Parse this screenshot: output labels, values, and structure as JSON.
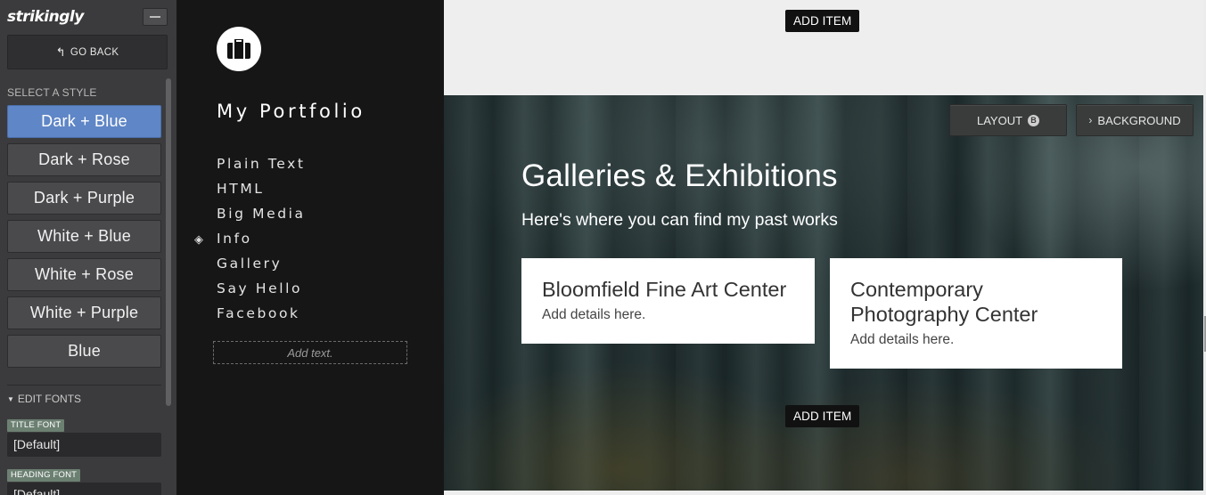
{
  "editor": {
    "logo": "strikingly",
    "go_back": "GO BACK",
    "select_style_label": "SELECT A STYLE",
    "styles": [
      {
        "label": "Dark + Blue",
        "active": true
      },
      {
        "label": "Dark + Rose",
        "active": false
      },
      {
        "label": "Dark + Purple",
        "active": false
      },
      {
        "label": "White + Blue",
        "active": false
      },
      {
        "label": "White + Rose",
        "active": false
      },
      {
        "label": "White + Purple",
        "active": false
      },
      {
        "label": "Blue",
        "active": false
      }
    ],
    "edit_fonts": "EDIT FONTS",
    "title_font_label": "TITLE FONT",
    "title_font_value": "[Default]",
    "heading_font_label": "HEADING FONT",
    "heading_font_value": "[Default]"
  },
  "site": {
    "title": "My Portfolio",
    "nav": [
      "Plain Text",
      "HTML",
      "Big Media",
      "Info",
      "Gallery",
      "Say Hello",
      "Facebook"
    ],
    "active_nav_index": 3,
    "add_text": "Add text."
  },
  "main": {
    "add_item_top": "ADD ITEM",
    "add_item_bottom": "ADD ITEM",
    "layout_button": "LAYOUT",
    "layout_badge": "B",
    "background_button": "BACKGROUND",
    "section_title": "Galleries & Exhibitions",
    "section_subtitle": "Here's where you can find my past works",
    "cards": [
      {
        "title": "Bloomfield Fine Art Center",
        "body": "Add details here."
      },
      {
        "title": "Contemporary Photography Center",
        "body": "Add details here."
      }
    ]
  },
  "colors": {
    "active_style": "#5f86c6",
    "editor_bg": "#3b3b3d",
    "site_nav_bg": "#161617"
  }
}
